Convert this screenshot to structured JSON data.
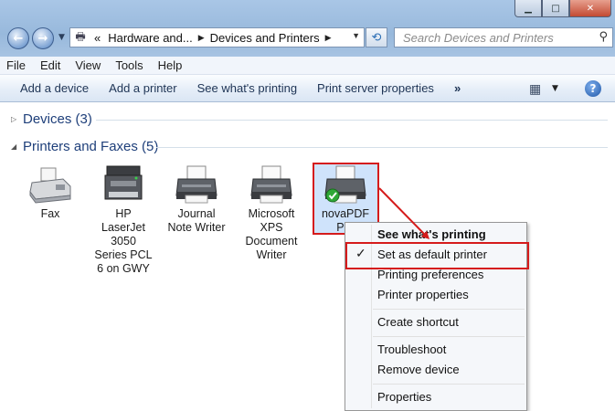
{
  "window": {
    "caption_buttons": [
      "min-icon",
      "max-icon",
      "close-icon"
    ]
  },
  "address": {
    "overflow": "«",
    "segments": [
      "Hardware and...",
      "Devices and Printers"
    ],
    "search_placeholder": "Search Devices and Printers"
  },
  "menu": [
    "File",
    "Edit",
    "View",
    "Tools",
    "Help"
  ],
  "commands": [
    "Add a device",
    "Add a printer",
    "See what's printing",
    "Print server properties"
  ],
  "commands_more": "»",
  "groups": {
    "devices": "Devices (3)",
    "printers": "Printers and Faxes (5)"
  },
  "printers": [
    {
      "label": "Fax",
      "icon": "fax-icon"
    },
    {
      "label": "HP LaserJet 3050 Series PCL 6 on GWY",
      "icon": "multifunction-printer-icon"
    },
    {
      "label": "Journal Note Writer",
      "icon": "printer-icon"
    },
    {
      "label": "Microsoft XPS Document Writer",
      "icon": "printer-icon"
    },
    {
      "label": "novaPDF Pro",
      "icon": "default-printer-icon"
    }
  ],
  "context_menu": [
    {
      "label": "See what's printing"
    },
    {
      "label": "Set as default printer",
      "checked": true
    },
    {
      "label": "Printing preferences"
    },
    {
      "label": "Printer properties"
    },
    {
      "label": "Create shortcut"
    },
    {
      "label": "Troubleshoot"
    },
    {
      "label": "Remove device"
    },
    {
      "label": "Properties"
    }
  ],
  "colors": {
    "highlight": "#d51b1b",
    "selection": "#cfe3fb",
    "group_header": "#1e3f7a"
  }
}
